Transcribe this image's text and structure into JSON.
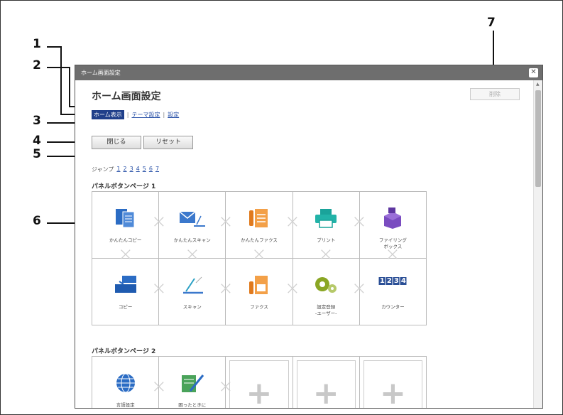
{
  "callouts": [
    "1",
    "2",
    "3",
    "4",
    "5",
    "6",
    "7"
  ],
  "window": {
    "titlebar_text": "ホーム画面設定",
    "close_glyph": "✕",
    "page_title": "ホーム画面設定",
    "delete_label": "削除"
  },
  "tabs": {
    "home_display": "ホーム表示",
    "theme_settings": "テーマ設定",
    "settings": "設定",
    "separator": "|"
  },
  "buttons": {
    "close": "閉じる",
    "reset": "リセット"
  },
  "jump": {
    "label": "ジャンプ",
    "pages": [
      "1",
      "2",
      "3",
      "4",
      "5",
      "6",
      "7"
    ]
  },
  "panel1": {
    "title": "パネルボタンページ 1",
    "items": [
      "かんたんコピー",
      "かんたんスキャン",
      "かんたんファクス",
      "プリント",
      "ファイリング\nボックス",
      "コピー",
      "スキャン",
      "ファクス",
      "設定登録\n-ユーザー-",
      "カウンター"
    ]
  },
  "panel2": {
    "title": "パネルボタンページ 2",
    "items": [
      "言語設定",
      "困ったときに\n画面で調べる"
    ]
  },
  "icons": {
    "copy": "easy-copy-icon",
    "scan": "easy-scan-icon",
    "fax": "easy-fax-icon",
    "print": "print-icon",
    "filing": "filing-box-icon",
    "accent": "#2b6cc4",
    "purple": "#7a4cc0",
    "green": "#8aa624"
  },
  "counter_digits": [
    "1",
    "2",
    "3",
    "4"
  ]
}
